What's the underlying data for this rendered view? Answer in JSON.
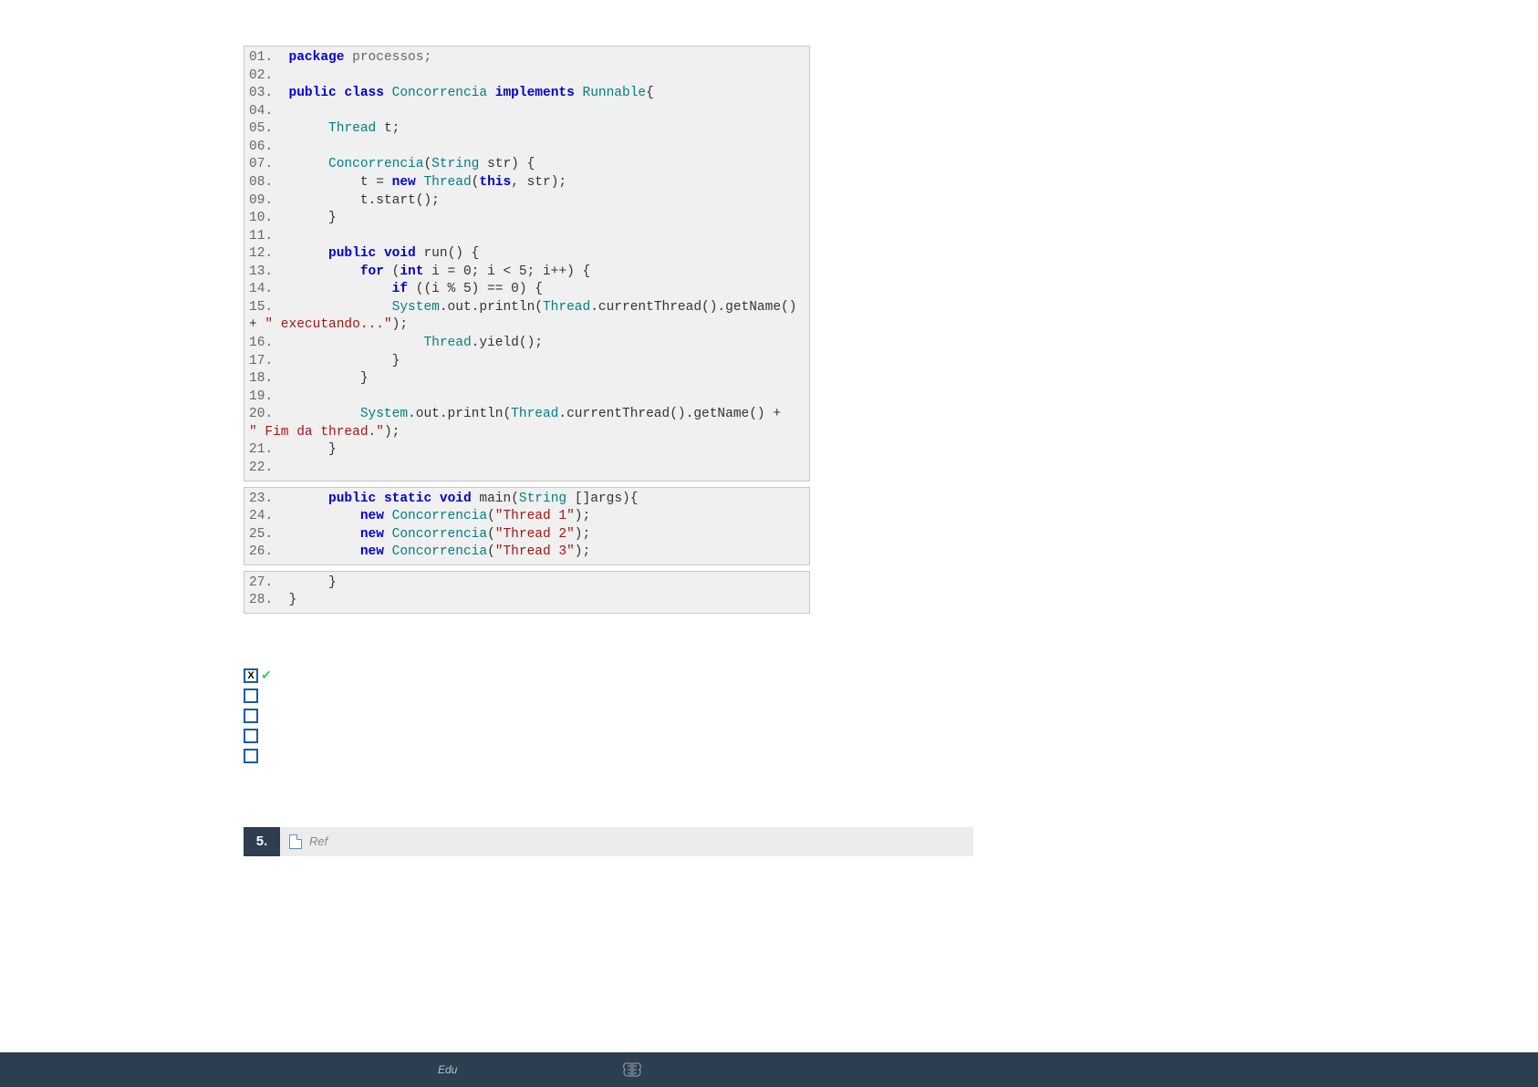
{
  "code_blocks": [
    {
      "lines": [
        {
          "num": "01.",
          "code_html": "<span class='kw'>package</span> <span class='gray'>processos;</span>"
        },
        {
          "num": "02.",
          "code_html": ""
        },
        {
          "num": "03.",
          "code_html": "<span class='kw'>public</span> <span class='kw'>class</span> <span class='cls'>Concorrencia</span> <span class='kw'>implements</span> <span class='cls'>Runnable</span>{"
        },
        {
          "num": "04.",
          "code_html": ""
        },
        {
          "num": "05.",
          "code_html": "     <span class='cls'>Thread</span> t;"
        },
        {
          "num": "06.",
          "code_html": ""
        },
        {
          "num": "07.",
          "code_html": "     <span class='cls'>Concorrencia</span>(<span class='cls'>String</span> str) {"
        },
        {
          "num": "08.",
          "code_html": "         t = <span class='kw'>new</span> <span class='cls'>Thread</span>(<span class='kw'>this</span>, str);"
        },
        {
          "num": "09.",
          "code_html": "         t.start();"
        },
        {
          "num": "10.",
          "code_html": "     }"
        },
        {
          "num": "11.",
          "code_html": ""
        },
        {
          "num": "12.",
          "code_html": "     <span class='kw'>public</span> <span class='kw'>void</span> run() {"
        },
        {
          "num": "13.",
          "code_html": "         <span class='kw'>for</span> (<span class='kw'>int</span> i = 0; i &lt; 5; i++) {"
        },
        {
          "num": "14.",
          "code_html": "             <span class='kw'>if</span> ((i % 5) == 0) {"
        },
        {
          "num": "15.",
          "code_html": "             <span class='cls'>System</span>.out.println(<span class='cls'>Thread</span>.currentThread().getName()",
          "wrap": "+ <span class='str'>\" executando...\"</span>);"
        },
        {
          "num": "16.",
          "code_html": "                 <span class='cls'>Thread</span>.yield();"
        },
        {
          "num": "17.",
          "code_html": "             }"
        },
        {
          "num": "18.",
          "code_html": "         }"
        },
        {
          "num": "19.",
          "code_html": ""
        },
        {
          "num": "20.",
          "code_html": "         <span class='cls'>System</span>.out.println(<span class='cls'>Thread</span>.currentThread().getName() +",
          "wrap": "<span class='str'>\" Fim da thread.\"</span>);"
        },
        {
          "num": "21.",
          "code_html": "     }"
        },
        {
          "num": "22.",
          "code_html": ""
        }
      ]
    },
    {
      "lines": [
        {
          "num": "23.",
          "code_html": "     <span class='kw'>public</span> <span class='kw'>static</span> <span class='kw'>void</span> main(<span class='cls'>String</span> []args){"
        },
        {
          "num": "24.",
          "code_html": "         <span class='kw'>new</span> <span class='cls'>Concorrencia</span>(<span class='str'>\"Thread 1\"</span>);"
        },
        {
          "num": "25.",
          "code_html": "         <span class='kw'>new</span> <span class='cls'>Concorrencia</span>(<span class='str'>\"Thread 2\"</span>);"
        },
        {
          "num": "26.",
          "code_html": "         <span class='kw'>new</span> <span class='cls'>Concorrencia</span>(<span class='str'>\"Thread 3\"</span>);"
        }
      ]
    },
    {
      "lines": [
        {
          "num": "27.",
          "code_html": "     }"
        },
        {
          "num": "28.",
          "code_html": "}"
        }
      ]
    }
  ],
  "answers": [
    {
      "correct": true,
      "marked": true,
      "symbol": "X"
    },
    {
      "correct": false,
      "marked": false,
      "symbol": ""
    },
    {
      "correct": false,
      "marked": false,
      "symbol": ""
    },
    {
      "correct": false,
      "marked": false,
      "symbol": ""
    },
    {
      "correct": false,
      "marked": false,
      "symbol": ""
    }
  ],
  "question": {
    "number": "5.",
    "label": "Ref"
  },
  "footer": {
    "edu_label": "Edu"
  }
}
